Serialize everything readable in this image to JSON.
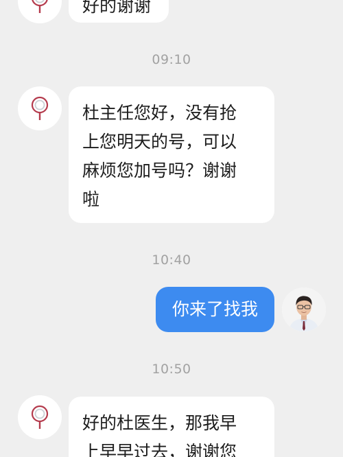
{
  "colors": {
    "page_background": "#efefef",
    "incoming_bubble": "#ffffff",
    "outgoing_bubble": "#3d8bf0",
    "timestamp_text": "#a2a2a2"
  },
  "messages": [
    {
      "type": "incoming",
      "text": "好的谢谢"
    },
    {
      "type": "timestamp",
      "text": "09:10"
    },
    {
      "type": "incoming",
      "text": "杜主任您好，没有抢\n上您明天的号，可以\n麻烦您加号吗？谢谢\n啦"
    },
    {
      "type": "timestamp",
      "text": "10:40"
    },
    {
      "type": "outgoing",
      "text": "你来了找我"
    },
    {
      "type": "timestamp",
      "text": "10:50"
    },
    {
      "type": "incoming",
      "text": "好的杜医生，那我早\n上早早过去，谢谢您"
    }
  ],
  "icons": {
    "patient_avatar": "magnifier-lens-icon",
    "doctor_avatar": "doctor-portrait"
  }
}
